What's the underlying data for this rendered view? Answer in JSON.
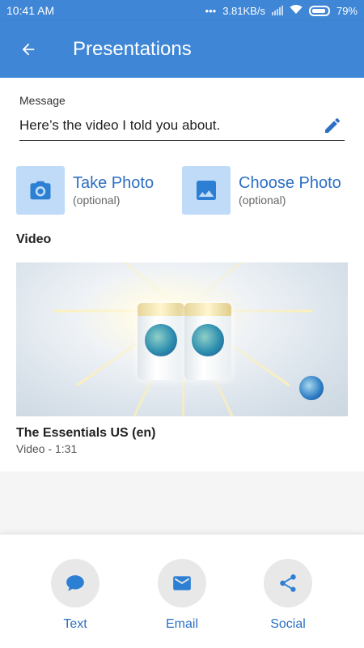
{
  "status": {
    "time": "10:41 AM",
    "net_speed": "3.81KB/s",
    "battery": "79%"
  },
  "appbar": {
    "title": "Presentations",
    "back_icon": "arrow-back-icon"
  },
  "message": {
    "label": "Message",
    "value": "Here’s the video I told you about.",
    "edit_icon": "pencil-icon"
  },
  "photos": [
    {
      "title": "Take Photo",
      "sub": "(optional)",
      "icon": "camera-icon"
    },
    {
      "title": "Choose Photo",
      "sub": "(optional)",
      "icon": "image-icon"
    }
  ],
  "video": {
    "section_label": "Video",
    "name": "The Essentials US (en)",
    "meta": "Video - 1:31"
  },
  "share": [
    {
      "label": "Text",
      "icon": "chat-icon"
    },
    {
      "label": "Email",
      "icon": "mail-icon"
    },
    {
      "label": "Social",
      "icon": "share-icon"
    }
  ],
  "colors": {
    "primary": "#3f86d6",
    "accent_text": "#2d6fc4",
    "tile_bg": "#bfdbf8"
  }
}
